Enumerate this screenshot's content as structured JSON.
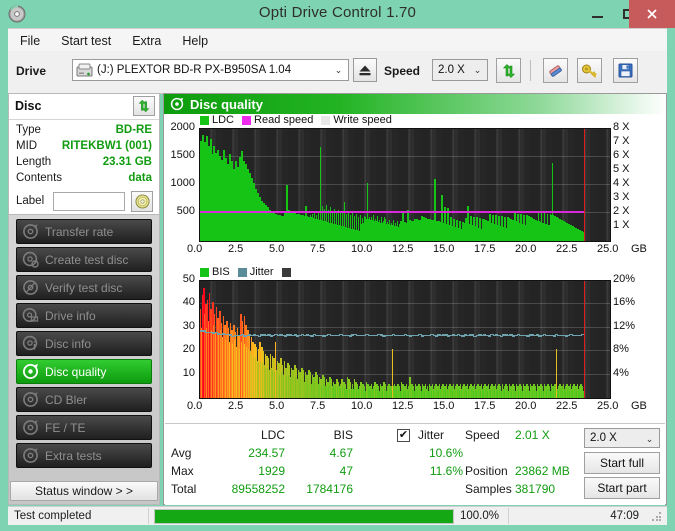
{
  "window": {
    "title": "Opti Drive Control 1.70",
    "app_icon": "disc-icon",
    "minimize": "–",
    "maximize": "□",
    "close": "✕"
  },
  "menu": {
    "items": [
      {
        "label": "File"
      },
      {
        "label": "Start test"
      },
      {
        "label": "Extra"
      },
      {
        "label": "Help"
      }
    ]
  },
  "toolbar": {
    "drive_label": "Drive",
    "drive_value": "(J:)  PLEXTOR BD-R  PX-B950SA 1.04",
    "drive_arrow": "⌄",
    "eject_icon": "eject-icon",
    "speed_label": "Speed",
    "speed_value": "2.0 X",
    "speed_arrow": "⌄",
    "refresh_icon": "refresh-icon",
    "erase_icon": "eraser-icon",
    "key_icon": "key-icon",
    "save_icon": "save-icon"
  },
  "disc": {
    "title": "Disc",
    "refresh_icon": "refresh-icon",
    "rows": [
      {
        "key": "Type",
        "value": "BD-RE"
      },
      {
        "key": "MID",
        "value": "RITEKBW1 (001)"
      },
      {
        "key": "Length",
        "value": "23.31 GB"
      },
      {
        "key": "Contents",
        "value": "data"
      }
    ],
    "label_caption": "Label",
    "label_value": "",
    "label_placeholder": "",
    "label_button_icon": "disc-label-icon"
  },
  "sidebar": {
    "items": [
      {
        "label": "Transfer rate",
        "icon": "disc-transfer-icon",
        "active": false
      },
      {
        "label": "Create test disc",
        "icon": "disc-create-icon",
        "active": false
      },
      {
        "label": "Verify test disc",
        "icon": "disc-verify-icon",
        "active": false
      },
      {
        "label": "Drive info",
        "icon": "drive-info-icon",
        "active": false
      },
      {
        "label": "Disc info",
        "icon": "disc-info-icon",
        "active": false
      },
      {
        "label": "Disc quality",
        "icon": "disc-quality-icon",
        "active": true
      },
      {
        "label": "CD Bler",
        "icon": "disc-bler-icon",
        "active": false
      },
      {
        "label": "FE / TE",
        "icon": "disc-fete-icon",
        "active": false
      },
      {
        "label": "Extra tests",
        "icon": "disc-extra-icon",
        "active": false
      }
    ],
    "status_window_button": "Status window > >"
  },
  "panel": {
    "title": "Disc quality",
    "icon": "disc-quality-icon"
  },
  "chart_data": [
    {
      "id": "ldc-chart",
      "type": "bar",
      "title": "Disc quality",
      "xlabel": "GB",
      "ylabel": "",
      "legend": [
        {
          "label": "LDC",
          "color": "#16c416"
        },
        {
          "label": "Read speed",
          "color": "#ee2aee"
        },
        {
          "label": "Write speed",
          "color": "#e8e8e8"
        }
      ],
      "legend_position": "top-left",
      "grid": true,
      "xlim": [
        0,
        25.0
      ],
      "ylim": [
        0,
        2000
      ],
      "y_ticks": [
        500,
        1000,
        1500,
        2000
      ],
      "x_ticks": [
        "0.0",
        "2.5",
        "5.0",
        "7.5",
        "10.0",
        "12.5",
        "15.0",
        "17.5",
        "20.0",
        "22.5",
        "25.0"
      ],
      "x_unit": "GB",
      "y2_label": "X",
      "y2_ticks": [
        "1 X",
        "2 X",
        "3 X",
        "4 X",
        "5 X",
        "6 X",
        "7 X",
        "8 X"
      ],
      "y2_lim": [
        0,
        8
      ],
      "read_speed_line_value": 2.0,
      "data_end_gb": 23.4,
      "series": [
        {
          "name": "LDC",
          "color": "#16c416",
          "values": [
            1780,
            1520,
            1900,
            1640,
            1760,
            1510,
            1880,
            1620,
            1700,
            1430,
            1820,
            1560,
            1480,
            1690,
            1350,
            1580,
            1410,
            1620,
            1300,
            1520,
            1190,
            1440,
            1230,
            1620,
            1300,
            1480,
            1110,
            1380,
            1240,
            1560,
            1180,
            1430,
            1010,
            1290,
            1150,
            1420,
            1070,
            1320,
            1190,
            1500,
            1240,
            1610,
            1320,
            1430,
            1240,
            1380,
            1060,
            1290,
            1130,
            1210,
            960,
            1120,
            880,
            1040,
            760,
            920,
            690,
            860,
            640,
            790,
            560,
            720,
            520,
            680,
            480,
            640,
            450,
            600,
            430,
            560,
            410,
            540,
            390,
            510,
            370,
            490,
            350,
            470,
            340,
            460,
            330,
            450,
            320,
            440,
            510,
            430,
            1000,
            420,
            560,
            400,
            540,
            390,
            520,
            380,
            500,
            370,
            490,
            360,
            480,
            350,
            470,
            340,
            460,
            330,
            450,
            620,
            440,
            330,
            430,
            460,
            420,
            480,
            410,
            500,
            400,
            470,
            390,
            530,
            380,
            1670,
            370,
            620,
            360,
            580,
            350,
            640,
            340,
            560,
            330,
            600,
            320,
            540,
            310,
            580,
            300,
            520,
            290,
            560,
            280,
            500,
            270,
            540,
            260,
            700,
            250,
            480,
            240,
            520,
            230,
            460,
            220,
            500,
            210,
            440,
            200,
            480,
            190,
            420,
            180,
            460,
            300,
            410,
            320,
            450,
            430,
            400,
            1040,
            390,
            430,
            380,
            420,
            370,
            460,
            360,
            400,
            350,
            440,
            340,
            380,
            330,
            420,
            320,
            360,
            430,
            400,
            310,
            340,
            300,
            380,
            290,
            330,
            280,
            370,
            270,
            320,
            260,
            360,
            250,
            310,
            350,
            300,
            500,
            290,
            340,
            280,
            330,
            560,
            320,
            370,
            310,
            360,
            300,
            350,
            400,
            340,
            390,
            330,
            380,
            320,
            370,
            440,
            360,
            420,
            350,
            410,
            340,
            400,
            330,
            390,
            320,
            380,
            310,
            370,
            1100,
            300,
            360,
            290,
            350,
            280,
            340,
            830,
            330,
            320,
            600,
            310,
            300,
            590,
            290,
            280,
            420,
            270,
            260,
            400,
            250,
            240,
            380,
            230,
            220,
            360,
            210,
            200,
            340,
            330,
            320,
            410,
            310,
            620,
            300,
            290,
            440,
            280,
            270,
            430,
            260,
            250,
            420,
            240,
            230,
            410,
            220,
            210,
            400,
            390,
            380,
            370,
            360,
            350,
            340,
            480,
            330,
            320,
            470,
            310,
            300,
            460,
            290,
            280,
            450,
            270,
            260,
            440,
            250,
            240,
            430,
            230,
            220,
            420,
            410,
            400,
            390,
            380,
            370,
            360,
            500,
            350,
            340,
            490,
            330,
            320,
            480,
            310,
            300,
            470,
            290,
            280,
            460,
            450,
            440,
            430,
            420,
            410,
            400,
            390,
            380,
            370,
            360,
            520,
            350,
            340,
            510,
            330,
            320,
            500,
            310,
            300,
            490,
            290,
            280,
            480,
            470,
            1390,
            460,
            450,
            440,
            430,
            420,
            410,
            400,
            390,
            380,
            370,
            360,
            350,
            340,
            330,
            320,
            310,
            300,
            290,
            280,
            270,
            260,
            250,
            240,
            230,
            220,
            210,
            200,
            190,
            180,
            170,
            160
          ]
        }
      ]
    },
    {
      "id": "bis-chart",
      "type": "bar",
      "title": "",
      "xlabel": "GB",
      "legend": [
        {
          "label": "BIS",
          "color": "#16c416"
        },
        {
          "label": "Jitter",
          "color": "#5b8d99"
        },
        {
          "label": "",
          "color": "#3a3a3a"
        }
      ],
      "legend_position": "top-left",
      "grid": true,
      "xlim": [
        0,
        25.0
      ],
      "ylim": [
        0,
        50
      ],
      "y_ticks": [
        10,
        20,
        30,
        40,
        50
      ],
      "x_ticks": [
        "0.0",
        "2.5",
        "5.0",
        "7.5",
        "10.0",
        "12.5",
        "15.0",
        "17.5",
        "20.0",
        "22.5",
        "25.0"
      ],
      "x_unit": "GB",
      "y2_ticks": [
        "4%",
        "8%",
        "12%",
        "16%",
        "20%"
      ],
      "y2_lim": [
        0,
        20
      ],
      "jitter_line_start_pct": 11.4,
      "jitter_line_value_pct": 10.6,
      "data_end_gb": 23.4,
      "series": [
        {
          "name": "BIS",
          "color_scale": "red-yellow-green",
          "values": [
            38,
            30,
            44,
            34,
            47,
            36,
            40,
            30,
            42,
            33,
            45,
            32,
            38,
            29,
            41,
            31,
            36,
            28,
            39,
            30,
            34,
            27,
            37,
            29,
            32,
            26,
            35,
            28,
            31,
            25,
            33,
            27,
            30,
            24,
            32,
            26,
            29,
            23,
            31,
            25,
            28,
            22,
            30,
            24,
            27,
            21,
            36,
            24,
            33,
            26,
            35,
            23,
            31,
            22,
            29,
            21,
            27,
            20,
            26,
            19,
            24,
            18,
            23,
            17,
            22,
            16,
            21,
            15,
            24,
            16,
            22,
            15,
            20,
            14,
            19,
            13,
            18,
            13,
            17,
            12,
            19,
            13,
            18,
            12,
            17,
            11,
            24,
            12,
            16,
            11,
            15,
            10,
            17,
            11,
            14,
            10,
            16,
            11,
            13,
            9,
            15,
            10,
            14,
            9,
            13,
            9,
            12,
            8,
            14,
            9,
            13,
            8,
            12,
            8,
            11,
            7,
            13,
            8,
            12,
            7,
            11,
            7,
            10,
            6,
            12,
            7,
            11,
            6,
            10,
            6,
            9,
            6,
            11,
            7,
            10,
            6,
            9,
            6,
            8,
            5,
            10,
            6,
            9,
            5,
            8,
            5,
            7,
            5,
            9,
            6,
            8,
            5,
            7,
            5,
            6,
            4,
            8,
            5,
            7,
            5,
            6,
            4,
            8,
            5,
            7,
            4,
            6,
            4,
            9,
            5,
            8,
            4,
            7,
            4,
            6,
            4,
            8,
            5,
            7,
            4,
            6,
            4,
            5,
            3,
            7,
            4,
            6,
            4,
            5,
            3,
            7,
            4,
            6,
            4,
            5,
            3,
            6,
            4,
            5,
            3,
            7,
            4,
            6,
            4,
            5,
            3,
            6,
            4,
            5,
            3,
            7,
            4,
            6,
            3,
            5,
            3,
            6,
            4,
            5,
            3,
            21,
            5,
            6,
            4,
            5,
            3,
            6,
            4,
            5,
            3,
            7,
            4,
            6,
            3,
            5,
            3,
            6,
            4,
            5,
            3,
            9,
            5,
            6,
            4,
            5,
            3,
            6,
            4,
            5,
            3,
            6,
            4,
            5,
            3,
            6,
            4,
            5,
            3,
            6,
            4,
            5,
            3,
            6,
            4,
            5,
            3,
            6,
            4,
            5,
            3,
            6,
            4,
            5,
            3,
            6,
            4,
            5,
            3,
            6,
            4,
            5,
            3,
            6,
            4,
            5,
            3,
            6,
            4,
            5,
            3,
            6,
            4,
            5,
            3,
            6,
            4,
            5,
            3,
            6,
            4,
            5,
            3,
            6,
            4,
            5,
            3,
            6,
            4,
            5,
            3,
            6,
            4,
            5,
            3,
            6,
            4,
            5,
            3,
            6,
            4,
            5,
            3,
            6,
            4,
            5,
            3,
            6,
            4,
            5,
            3,
            6,
            4,
            5,
            3,
            6,
            4,
            5,
            3,
            6,
            4,
            5,
            3,
            6,
            4,
            5,
            3,
            6,
            4,
            5,
            3,
            6,
            4,
            5,
            3,
            6,
            4,
            5,
            3,
            6,
            4,
            5,
            3,
            6,
            4,
            5,
            3,
            6,
            4,
            5,
            3,
            6,
            4,
            5,
            3,
            6,
            4,
            5,
            3,
            6,
            4,
            5,
            3,
            6,
            4,
            5,
            3,
            6,
            4,
            5,
            3,
            6,
            4,
            5,
            3,
            6,
            4,
            5,
            3,
            6,
            4,
            5,
            3,
            6,
            4,
            5,
            3,
            6,
            4,
            21,
            4,
            5,
            3,
            6,
            4,
            5,
            3,
            6,
            4,
            5,
            3,
            6,
            4,
            5,
            3,
            6,
            4,
            5,
            3,
            6,
            4,
            5,
            3,
            6,
            4,
            5,
            3,
            6,
            4,
            5,
            3
          ]
        }
      ]
    }
  ],
  "stats": {
    "col_headers": [
      "LDC",
      "BIS"
    ],
    "jitter_label": "Jitter",
    "jitter_checked": true,
    "jitter_check_glyph": "✔",
    "rows": [
      {
        "label": "Avg",
        "ldc": "234.57",
        "bis": "4.67",
        "jitter": "10.6%"
      },
      {
        "label": "Max",
        "ldc": "1929",
        "bis": "47",
        "jitter": "11.6%"
      },
      {
        "label": "Total",
        "ldc": "89558252",
        "bis": "1784176",
        "jitter": ""
      }
    ],
    "right": [
      {
        "label": "Speed",
        "value": "2.01 X"
      },
      {
        "label": "Position",
        "value": "23862 MB"
      },
      {
        "label": "Samples",
        "value": "381790"
      }
    ],
    "speed_select": "2.0 X",
    "speed_arrow": "⌄",
    "start_full_button": "Start full",
    "start_part_button": "Start part"
  },
  "statusbar": {
    "message": "Test completed",
    "progress_percent": "100.0%",
    "progress_value": 100,
    "elapsed": "47:09"
  }
}
